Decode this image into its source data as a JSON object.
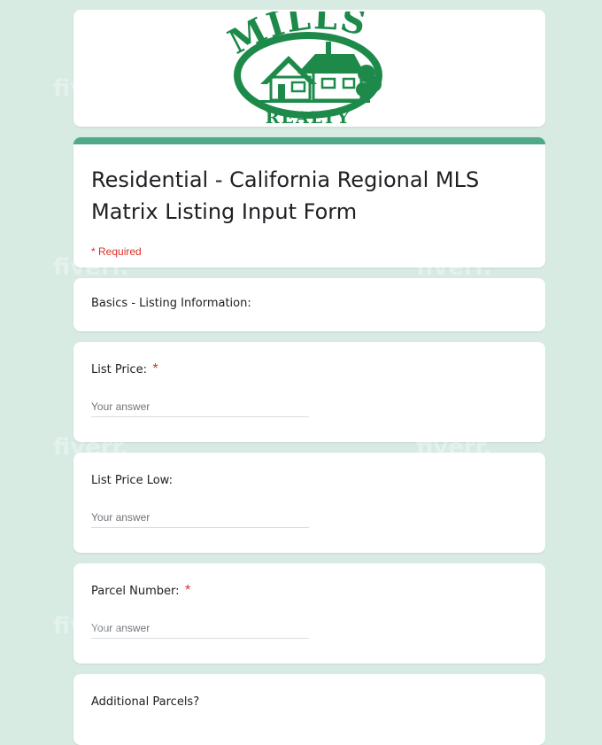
{
  "banner": {
    "logo_top": "MILLS",
    "logo_bottom": "REALTY",
    "brand_color": "#1d8a4a"
  },
  "form": {
    "title": "Residential - California Regional MLS Matrix Listing Input Form",
    "required_note": "* Required",
    "accent_color": "#52a98a"
  },
  "section": {
    "title": "Basics - Listing Information:"
  },
  "questions": [
    {
      "label": "List Price:",
      "required": "*",
      "placeholder": "Your answer"
    },
    {
      "label": "List Price Low:",
      "required": "",
      "placeholder": "Your answer"
    },
    {
      "label": "Parcel Number:",
      "required": "*",
      "placeholder": "Your answer"
    },
    {
      "label": "Additional Parcels?",
      "required": "",
      "placeholder": ""
    }
  ],
  "watermark": {
    "text": "fiverr."
  },
  "colors": {
    "page_bg": "#d7ebe3",
    "required": "#d93025"
  }
}
